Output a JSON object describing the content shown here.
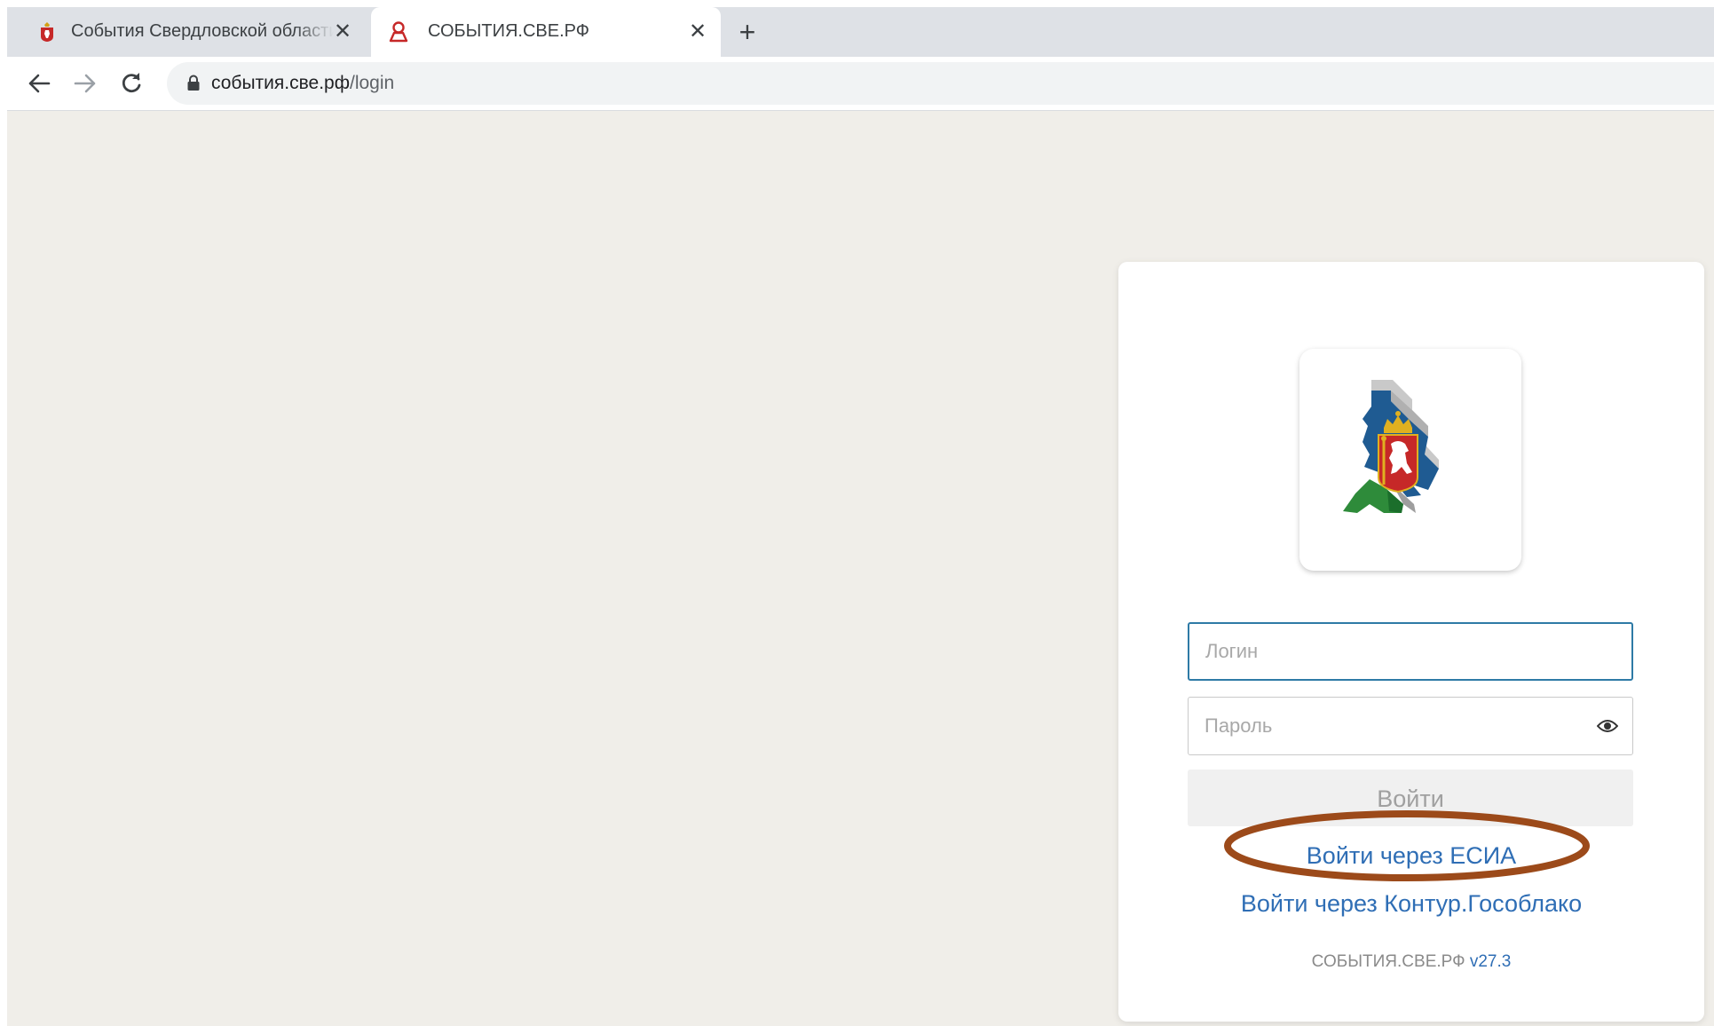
{
  "tabs": [
    {
      "title": "События Свердловской области",
      "favicon": "sverdlovsk-crest-icon",
      "active": false
    },
    {
      "title": "СОБЫТИЯ.СВЕ.РФ",
      "favicon": "person-outline-icon",
      "active": true
    }
  ],
  "tab_close_glyph": "✕",
  "new_tab_glyph": "+",
  "address_bar": {
    "host": "события.све.рф",
    "path": "/login"
  },
  "login_form": {
    "login_placeholder": "Логин",
    "password_placeholder": "Пароль",
    "submit_label": "Войти",
    "esia_link": "Войти через ЕСИА",
    "kontur_link": "Войти через Контур.Гособлако",
    "version_name": "СОБЫТИЯ.СВЕ.РФ",
    "version_number": "v27.3"
  },
  "colors": {
    "page_background": "#f0eee9",
    "link": "#2f6eb5",
    "login_border_focus": "#2e7aa6",
    "highlight_annotation": "#9c4a1a"
  },
  "icons": {
    "back": "arrow-left-icon",
    "forward": "arrow-right-icon",
    "reload": "reload-icon",
    "lock": "lock-icon",
    "password_visibility": "eye-icon",
    "logo": "sverdlovsk-region-logo"
  }
}
